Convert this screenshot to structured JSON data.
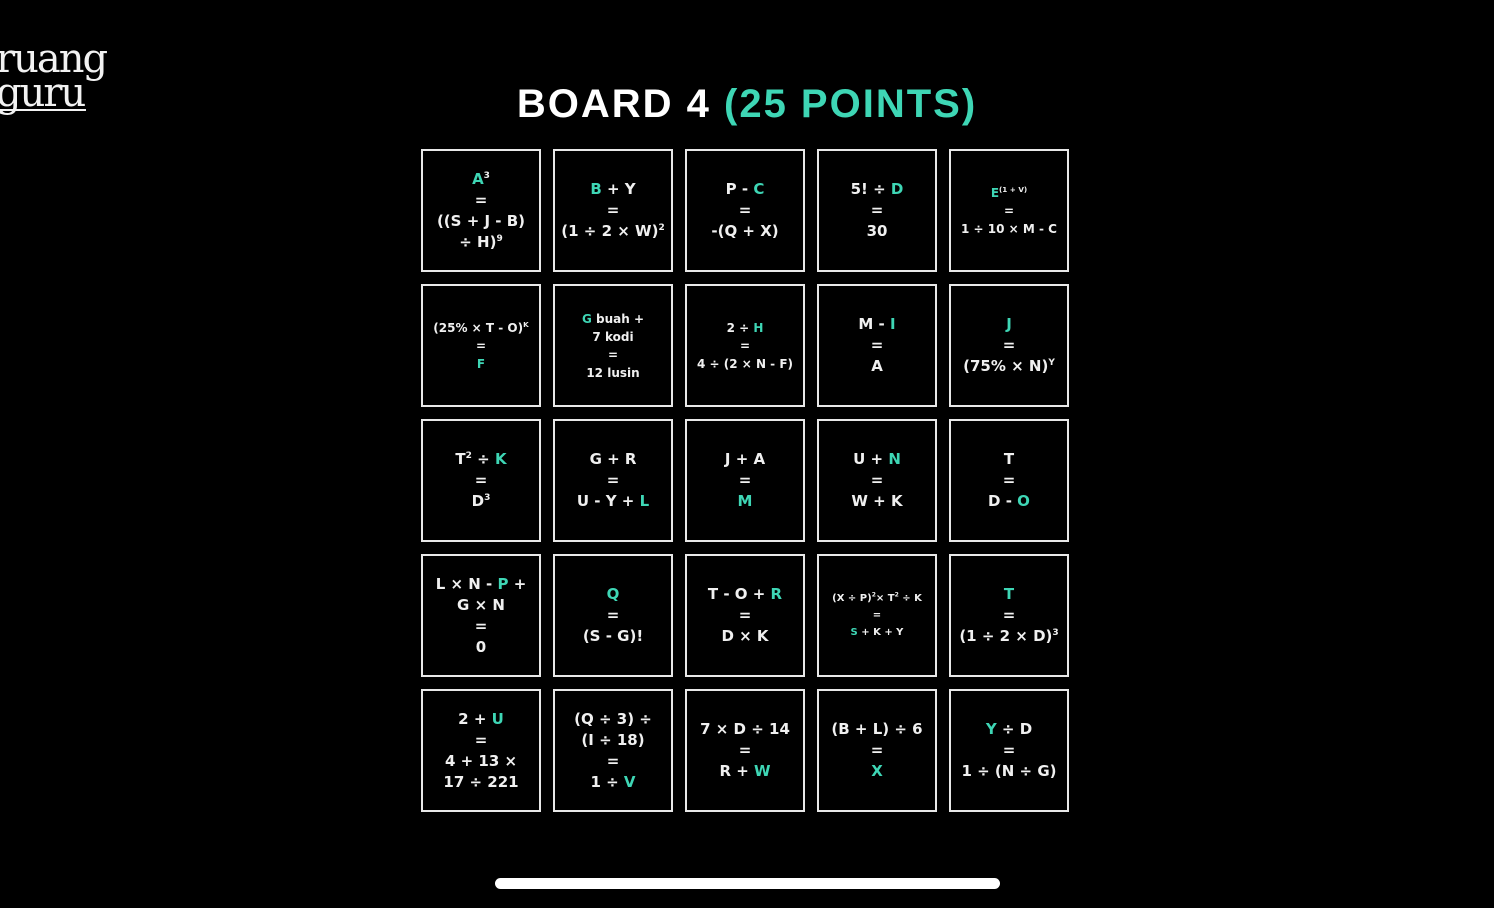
{
  "logo": {
    "line1": "ruang",
    "line2": "guru"
  },
  "header": {
    "title_main": "BOARD 4",
    "title_points": "(25 POINTS)"
  },
  "colors": {
    "accent": "#3ed6b5",
    "background": "#000000",
    "text": "#f0f0f0"
  },
  "tiles": [
    {
      "size": "normal",
      "lines": [
        [
          {
            "t": "A",
            "v": true
          },
          {
            "t": "3",
            "sup": true
          }
        ],
        [
          {
            "t": "="
          }
        ],
        [
          {
            "t": "((S + J - B)"
          }
        ],
        [
          {
            "t": "÷ H)"
          },
          {
            "t": "9",
            "sup": true
          }
        ]
      ]
    },
    {
      "size": "normal",
      "lines": [
        [
          {
            "t": "B",
            "v": true
          },
          {
            "t": " + Y"
          }
        ],
        [
          {
            "t": "="
          }
        ],
        [
          {
            "t": "(1 ÷ 2 × W)"
          },
          {
            "t": "2",
            "sup": true
          }
        ]
      ]
    },
    {
      "size": "normal",
      "lines": [
        [
          {
            "t": "P - "
          },
          {
            "t": "C",
            "v": true
          }
        ],
        [
          {
            "t": "="
          }
        ],
        [
          {
            "t": "-(Q + X)"
          }
        ]
      ]
    },
    {
      "size": "normal",
      "lines": [
        [
          {
            "t": "5! ÷ "
          },
          {
            "t": "D",
            "v": true
          }
        ],
        [
          {
            "t": "="
          }
        ],
        [
          {
            "t": "30"
          }
        ]
      ]
    },
    {
      "size": "small",
      "lines": [
        [
          {
            "t": "E",
            "v": true
          },
          {
            "t": "(1 + V)",
            "sup": true
          }
        ],
        [
          {
            "t": "="
          }
        ],
        [
          {
            "t": "1 ÷ 10 × M - C"
          }
        ]
      ]
    },
    {
      "size": "small",
      "lines": [
        [
          {
            "t": "(25% × T - O)"
          },
          {
            "t": "K",
            "sup": true
          }
        ],
        [
          {
            "t": "="
          }
        ],
        [
          {
            "t": "F",
            "v": true
          }
        ]
      ]
    },
    {
      "size": "small",
      "lines": [
        [
          {
            "t": "G",
            "v": true
          },
          {
            "t": " buah +"
          }
        ],
        [
          {
            "t": "7 kodi"
          }
        ],
        [
          {
            "t": "="
          }
        ],
        [
          {
            "t": "12 lusin"
          }
        ]
      ]
    },
    {
      "size": "small",
      "lines": [
        [
          {
            "t": "2 ÷ "
          },
          {
            "t": "H",
            "v": true
          }
        ],
        [
          {
            "t": "="
          }
        ],
        [
          {
            "t": "4 ÷ (2 × N - F)"
          }
        ]
      ]
    },
    {
      "size": "normal",
      "lines": [
        [
          {
            "t": "M - "
          },
          {
            "t": "I",
            "v": true
          }
        ],
        [
          {
            "t": "="
          }
        ],
        [
          {
            "t": "A"
          }
        ]
      ]
    },
    {
      "size": "normal",
      "lines": [
        [
          {
            "t": "J",
            "v": true
          }
        ],
        [
          {
            "t": "="
          }
        ],
        [
          {
            "t": "(75% × N)"
          },
          {
            "t": "Y",
            "sup": true
          }
        ]
      ]
    },
    {
      "size": "normal",
      "lines": [
        [
          {
            "t": "T"
          },
          {
            "t": "2",
            "sup": true
          },
          {
            "t": " ÷ "
          },
          {
            "t": "K",
            "v": true
          }
        ],
        [
          {
            "t": "="
          }
        ],
        [
          {
            "t": "D"
          },
          {
            "t": "3",
            "sup": true
          }
        ]
      ]
    },
    {
      "size": "normal",
      "lines": [
        [
          {
            "t": "G + R"
          }
        ],
        [
          {
            "t": "="
          }
        ],
        [
          {
            "t": "U - Y + "
          },
          {
            "t": "L",
            "v": true
          }
        ]
      ]
    },
    {
      "size": "normal",
      "lines": [
        [
          {
            "t": "J + A"
          }
        ],
        [
          {
            "t": "="
          }
        ],
        [
          {
            "t": "M",
            "v": true
          }
        ]
      ]
    },
    {
      "size": "normal",
      "lines": [
        [
          {
            "t": "U + "
          },
          {
            "t": "N",
            "v": true
          }
        ],
        [
          {
            "t": "="
          }
        ],
        [
          {
            "t": "W + K"
          }
        ]
      ]
    },
    {
      "size": "normal",
      "lines": [
        [
          {
            "t": "T"
          }
        ],
        [
          {
            "t": "="
          }
        ],
        [
          {
            "t": "D - "
          },
          {
            "t": "O",
            "v": true
          }
        ]
      ]
    },
    {
      "size": "normal",
      "lines": [
        [
          {
            "t": "L × N - "
          },
          {
            "t": "P",
            "v": true
          },
          {
            "t": " +"
          }
        ],
        [
          {
            "t": "G × N"
          }
        ],
        [
          {
            "t": "="
          }
        ],
        [
          {
            "t": "0"
          }
        ]
      ]
    },
    {
      "size": "normal",
      "lines": [
        [
          {
            "t": "Q",
            "v": true
          }
        ],
        [
          {
            "t": "="
          }
        ],
        [
          {
            "t": "(S - G)!"
          }
        ]
      ]
    },
    {
      "size": "normal",
      "lines": [
        [
          {
            "t": "T - O + "
          },
          {
            "t": "R",
            "v": true
          }
        ],
        [
          {
            "t": "="
          }
        ],
        [
          {
            "t": "D × K"
          }
        ]
      ]
    },
    {
      "size": "tiny",
      "lines": [
        [
          {
            "t": "(X ÷ P)"
          },
          {
            "t": "2",
            "sup": true
          },
          {
            "t": "× T"
          },
          {
            "t": "2",
            "sup": true
          },
          {
            "t": " ÷ K"
          }
        ],
        [
          {
            "t": "="
          }
        ],
        [
          {
            "t": "S",
            "v": true
          },
          {
            "t": " + K + Y"
          }
        ]
      ]
    },
    {
      "size": "normal",
      "lines": [
        [
          {
            "t": "T",
            "v": true
          }
        ],
        [
          {
            "t": "="
          }
        ],
        [
          {
            "t": "(1 ÷ 2 × D)"
          },
          {
            "t": "3",
            "sup": true
          }
        ]
      ]
    },
    {
      "size": "normal",
      "lines": [
        [
          {
            "t": "2 + "
          },
          {
            "t": "U",
            "v": true
          }
        ],
        [
          {
            "t": "="
          }
        ],
        [
          {
            "t": "4 + 13 ×"
          }
        ],
        [
          {
            "t": "17 ÷ 221"
          }
        ]
      ]
    },
    {
      "size": "normal",
      "lines": [
        [
          {
            "t": "(Q ÷ 3) ÷"
          }
        ],
        [
          {
            "t": "(I ÷ 18)"
          }
        ],
        [
          {
            "t": "="
          }
        ],
        [
          {
            "t": "1 ÷ "
          },
          {
            "t": "V",
            "v": true
          }
        ]
      ]
    },
    {
      "size": "normal",
      "lines": [
        [
          {
            "t": "7 × D ÷ 14"
          }
        ],
        [
          {
            "t": "="
          }
        ],
        [
          {
            "t": "R + "
          },
          {
            "t": "W",
            "v": true
          }
        ]
      ]
    },
    {
      "size": "normal",
      "lines": [
        [
          {
            "t": "(B + L) ÷ 6"
          }
        ],
        [
          {
            "t": "="
          }
        ],
        [
          {
            "t": "X",
            "v": true
          }
        ]
      ]
    },
    {
      "size": "normal",
      "lines": [
        [
          {
            "t": "Y",
            "v": true
          },
          {
            "t": " ÷ D"
          }
        ],
        [
          {
            "t": "="
          }
        ],
        [
          {
            "t": "1 ÷ (N ÷ G)"
          }
        ]
      ]
    }
  ]
}
